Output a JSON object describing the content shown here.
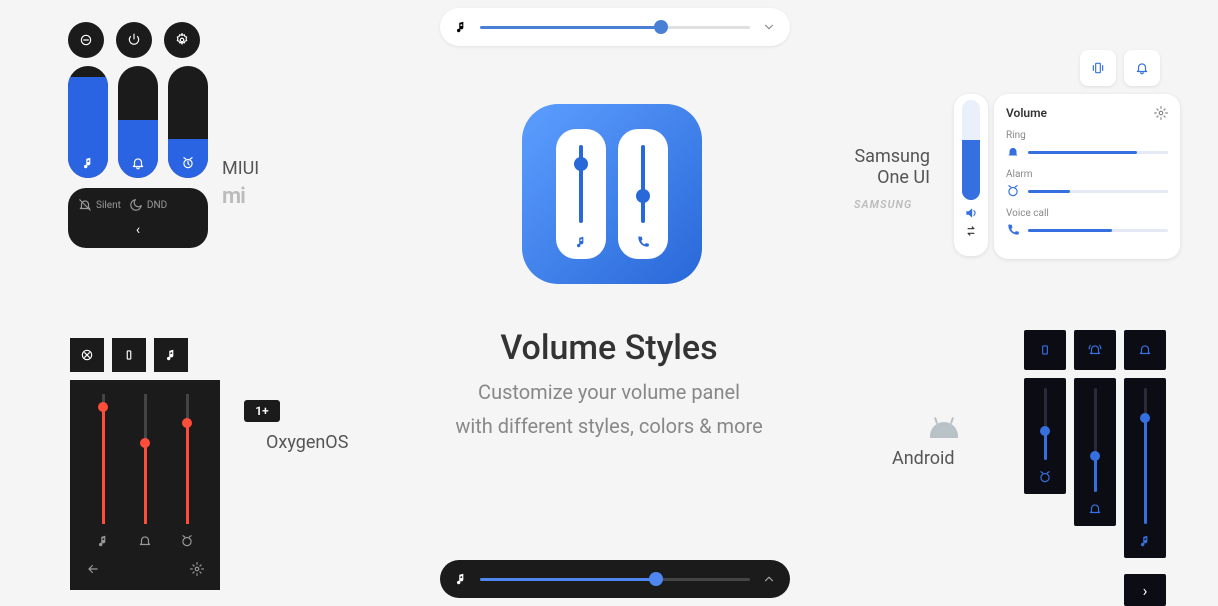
{
  "title": "Volume Styles",
  "subtitle_line1": "Customize your volume panel",
  "subtitle_line2": "with different styles, colors & more",
  "styles": {
    "miui": {
      "label": "MIUI",
      "brand": "mi",
      "silent": "Silent",
      "dnd": "DND"
    },
    "samsung": {
      "label_line1": "Samsung",
      "label_line2": "One UI",
      "brand": "SAMSUNG",
      "panel_title": "Volume",
      "channels": [
        {
          "name": "Ring",
          "level_pct": 78
        },
        {
          "name": "Alarm",
          "level_pct": 30
        },
        {
          "name": "Voice call",
          "level_pct": 60
        }
      ]
    },
    "oxygen": {
      "label": "OxygenOS",
      "brand": "1+"
    },
    "android": {
      "label": "Android"
    }
  },
  "top_slider": {
    "value_pct": 67
  },
  "bottom_slider": {
    "value_pct": 65
  }
}
